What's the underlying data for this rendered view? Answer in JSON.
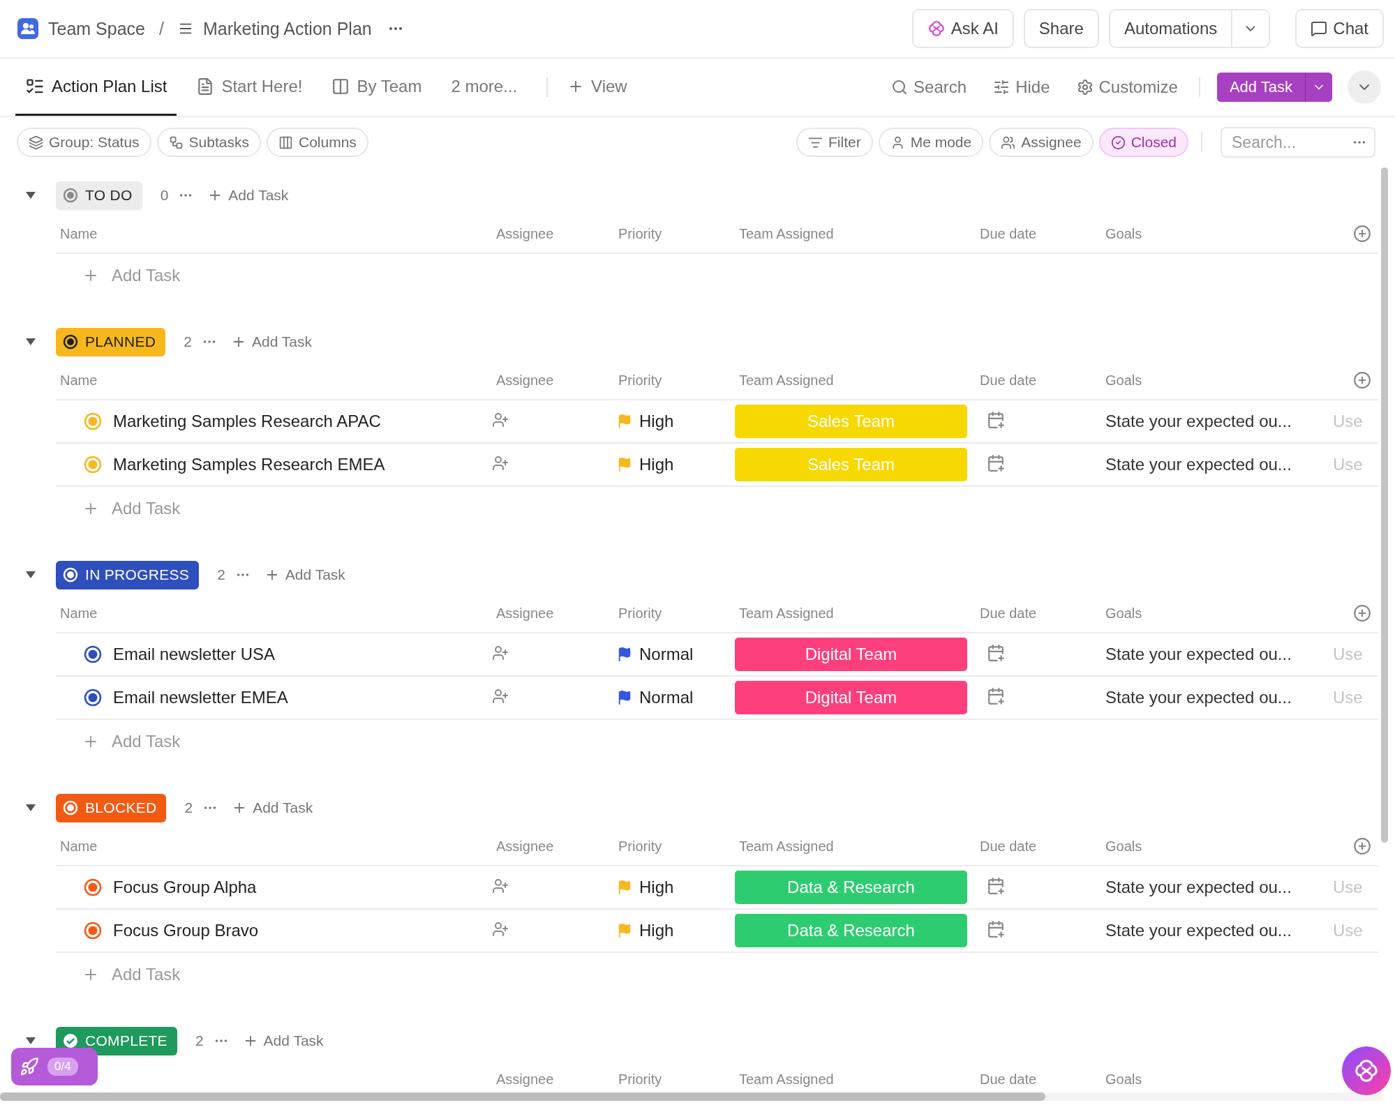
{
  "breadcrumb": {
    "space": "Team Space",
    "separator": "/",
    "list": "Marketing Action Plan"
  },
  "header_actions": [
    {
      "label": "Ask AI",
      "kind": "ai"
    },
    {
      "label": "Share",
      "kind": "plain"
    },
    {
      "label": "Automations",
      "kind": "split"
    },
    {
      "label": "Chat",
      "kind": "chat"
    }
  ],
  "views": [
    {
      "label": "Action Plan List",
      "kind": "list",
      "selected": true
    },
    {
      "label": "Start Here!",
      "kind": "doc",
      "selected": false
    },
    {
      "label": "By Team",
      "kind": "board",
      "selected": false
    },
    {
      "label": "2 more...",
      "kind": "more",
      "selected": false
    }
  ],
  "add_view": "View",
  "view_tools": [
    {
      "label": "Search",
      "kind": "search"
    },
    {
      "label": "Hide",
      "kind": "hide"
    },
    {
      "label": "Customize",
      "kind": "customize"
    }
  ],
  "add_task_button": "Add Task",
  "left_filters": [
    {
      "label": "Group: Status",
      "kind": "group"
    },
    {
      "label": "Subtasks",
      "kind": "subtasks"
    },
    {
      "label": "Columns",
      "kind": "columns"
    }
  ],
  "right_filters": [
    {
      "label": "Filter",
      "kind": "filter",
      "selected": false
    },
    {
      "label": "Me mode",
      "kind": "me",
      "selected": false
    },
    {
      "label": "Assignee",
      "kind": "assignee",
      "selected": false
    },
    {
      "label": "Closed",
      "kind": "closed",
      "selected": true
    }
  ],
  "search": {
    "placeholder": "Search..."
  },
  "groups": [
    {
      "status": "TO DO",
      "kind": "todo",
      "color": "#8a8a8a",
      "count": "0",
      "expanded": true,
      "add_task": "Add Task",
      "columns": [
        "Name",
        "Assignee",
        "Priority",
        "Team Assigned",
        "Due date",
        "Goals"
      ],
      "add_row": "Add Task"
    },
    {
      "status": "PLANNED",
      "kind": "planned",
      "color": "#f6b81c",
      "count": "2",
      "expanded": true,
      "add_task": "Add Task",
      "columns": [
        "Name",
        "Assignee",
        "Priority",
        "Team Assigned",
        "Due date",
        "Goals"
      ],
      "tasks": [
        {
          "name": "Marketing Samples Research APAC",
          "priority": {
            "label": "High",
            "color": "#f8b920"
          },
          "team": {
            "label": "Sales Team",
            "color": "#f7d800"
          },
          "goals": "State your expected ou...",
          "column_7": "Use"
        },
        {
          "name": "Marketing Samples Research EMEA",
          "priority": {
            "label": "High",
            "color": "#f8b920"
          },
          "team": {
            "label": "Sales Team",
            "color": "#f7d800"
          },
          "goals": "State your expected ou...",
          "column_7": "Use"
        }
      ],
      "add_row": "Add Task"
    },
    {
      "status": "IN PROGRESS",
      "kind": "in_progress",
      "color": "#2f4fbd",
      "count": "2",
      "expanded": true,
      "add_task": "Add Task",
      "columns": [
        "Name",
        "Assignee",
        "Priority",
        "Team Assigned",
        "Due date",
        "Goals"
      ],
      "tasks": [
        {
          "name": "Email newsletter USA",
          "priority": {
            "label": "Normal",
            "color": "#3557e0"
          },
          "team": {
            "label": "Digital Team",
            "color": "#fd3f7c"
          },
          "goals": "State your expected ou...",
          "column_7": "Use"
        },
        {
          "name": "Email newsletter EMEA",
          "priority": {
            "label": "Normal",
            "color": "#3557e0"
          },
          "team": {
            "label": "Digital Team",
            "color": "#fd3f7c"
          },
          "goals": "State your expected ou...",
          "column_7": "Use"
        }
      ],
      "add_row": "Add Task"
    },
    {
      "status": "BLOCKED",
      "kind": "blocked",
      "color": "#f25a13",
      "count": "2",
      "expanded": true,
      "add_task": "Add Task",
      "columns": [
        "Name",
        "Assignee",
        "Priority",
        "Team Assigned",
        "Due date",
        "Goals"
      ],
      "tasks": [
        {
          "name": "Focus Group Alpha",
          "priority": {
            "label": "High",
            "color": "#f8b920"
          },
          "team": {
            "label": "Data & Research",
            "color": "#2ecc71"
          },
          "goals": "State your expected ou...",
          "column_7": "Use"
        },
        {
          "name": "Focus Group Bravo",
          "priority": {
            "label": "High",
            "color": "#f8b920"
          },
          "team": {
            "label": "Data & Research",
            "color": "#2ecc71"
          },
          "goals": "State your expected ou...",
          "column_7": "Use"
        }
      ],
      "add_row": "Add Task"
    },
    {
      "status": "COMPLETE",
      "kind": "complete",
      "color": "#1e9a5c",
      "count": "2",
      "expanded": true,
      "add_task": "Add Task",
      "columns": [
        {
          "kind": "assignee",
          "label": "Assignee"
        },
        {
          "kind": "priority",
          "label": "Priority"
        },
        {
          "kind": "team",
          "label": "Team Assigned"
        },
        {
          "kind": "due",
          "label": "Due date"
        },
        {
          "kind": "goals",
          "label": "Goals"
        }
      ]
    }
  ],
  "onboarding": {
    "progress": "0/4"
  }
}
